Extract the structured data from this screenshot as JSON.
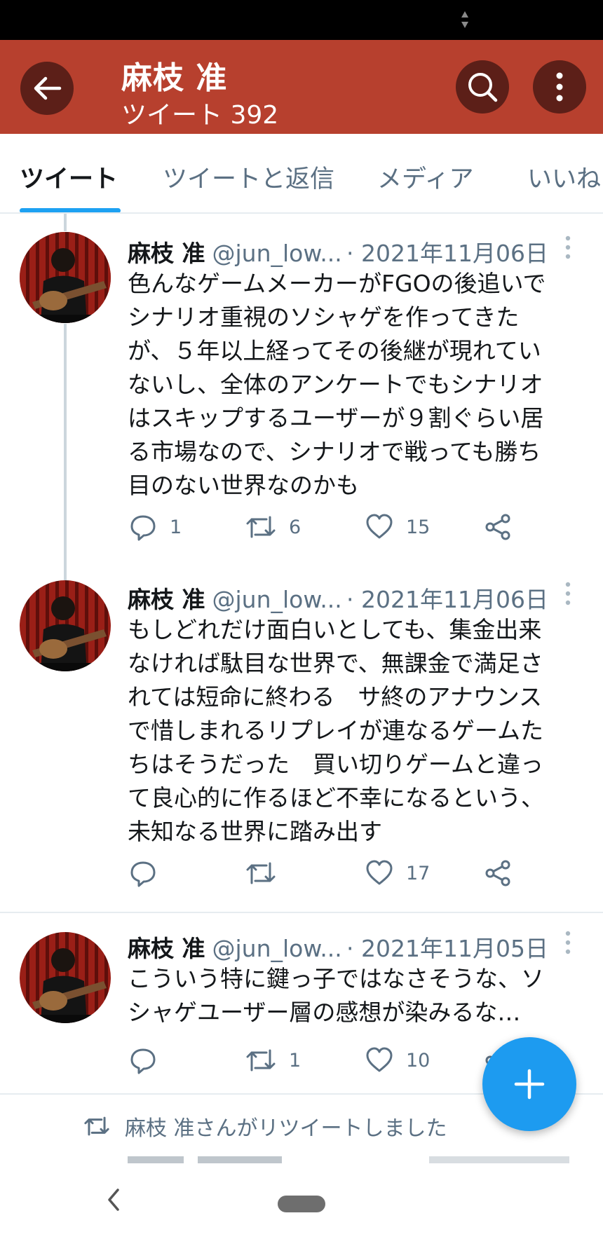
{
  "colors": {
    "app_bar": "#b7402e",
    "app_bar_button": "#5c1f18",
    "accent": "#1da1f2",
    "text_primary": "#14171a",
    "text_secondary": "#5b7083",
    "divider": "#e6ecf0"
  },
  "header": {
    "title": "麻枝 准",
    "subtitle": "ツイート 392",
    "back_icon": "arrow-left-icon",
    "search_icon": "search-icon",
    "more_icon": "more-vertical-icon"
  },
  "tabs": [
    {
      "label": "ツイート",
      "active": true
    },
    {
      "label": "ツイートと返信",
      "active": false
    },
    {
      "label": "メディア",
      "active": false
    },
    {
      "label": "いいね",
      "active": false
    }
  ],
  "tweets": [
    {
      "name": "麻枝 准",
      "handle": "@jun_low...",
      "date": "· 2021年11月06日",
      "lines": [
        "色んなゲームメーカーがFGOの後追いで",
        "シナリオ重視のソシャゲを作ってきた",
        "が、５年以上経ってその後継が現れてい",
        "ないし、全体のアンケートでもシナリオ",
        "はスキップするユーザーが９割ぐらい居",
        "る市場なので、シナリオで戦っても勝ち",
        "目のない世界なのかも"
      ],
      "replies": "1",
      "retweets": "6",
      "likes": "15"
    },
    {
      "name": "麻枝 准",
      "handle": "@jun_low...",
      "date": "· 2021年11月06日",
      "lines": [
        "もしどれだけ面白いとしても、集金出来",
        "なければ駄目な世界で、無課金で満足さ",
        "れては短命に終わる　サ終のアナウンス",
        "で惜しまれるリプレイが連なるゲームた",
        "ちはそうだった　買い切りゲームと違っ",
        "て良心的に作るほど不幸になるという、",
        "未知なる世界に踏み出す"
      ],
      "replies": "",
      "retweets": "",
      "likes": "17"
    },
    {
      "name": "麻枝 准",
      "handle": "@jun_low...",
      "date": "· 2021年11月05日",
      "lines": [
        "こういう特に鍵っ子ではなさそうな、ソ",
        "シャゲユーザー層の感想が染みるな…"
      ],
      "replies": "",
      "retweets": "1",
      "likes": "10"
    }
  ],
  "retweet_notice": "麻枝 准さんがリツイートしました",
  "fab_icon": "plus-icon",
  "nav": {
    "back_icon": "chevron-left-icon",
    "home_icon": "home-pill-icon"
  }
}
